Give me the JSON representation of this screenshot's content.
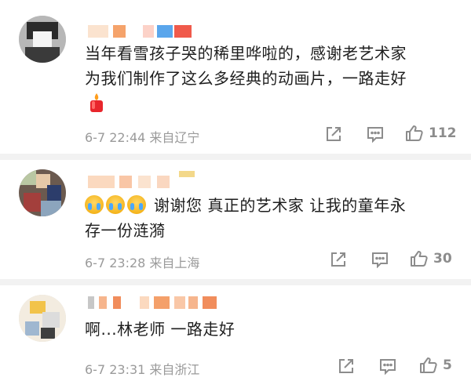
{
  "comments": [
    {
      "text": "当年看雪孩子哭的稀里哗啦的，感谢老艺术家为我们制作了这么多经典的动画片，一路走好",
      "text_line1": "当年看雪孩子哭的稀里哗啦的，感谢老艺术家",
      "text_line2": "为我们制作了这么多经典的动画片，一路走好",
      "meta": "6-7 22:44 来自辽宁",
      "likes": "112"
    },
    {
      "text_line1": "谢谢您 真正的艺术家 让我的童年永",
      "text_line2": "存一份涟漪",
      "meta": "6-7 23:28 来自上海",
      "likes": "30"
    },
    {
      "text_line1": "啊...林老师 一路走好",
      "meta": "6-7 23:31 来自浙江",
      "likes": "5"
    }
  ],
  "icons": {
    "share": "share-icon",
    "comment": "comment-icon",
    "like": "thumbs-up-icon",
    "candle": "candle-emoji-icon",
    "crying": "crying-emoji-icon"
  },
  "colors": {
    "meta_text": "#9a9a9a",
    "icon": "#8c8c8c",
    "divider": "#f2f2f2"
  }
}
